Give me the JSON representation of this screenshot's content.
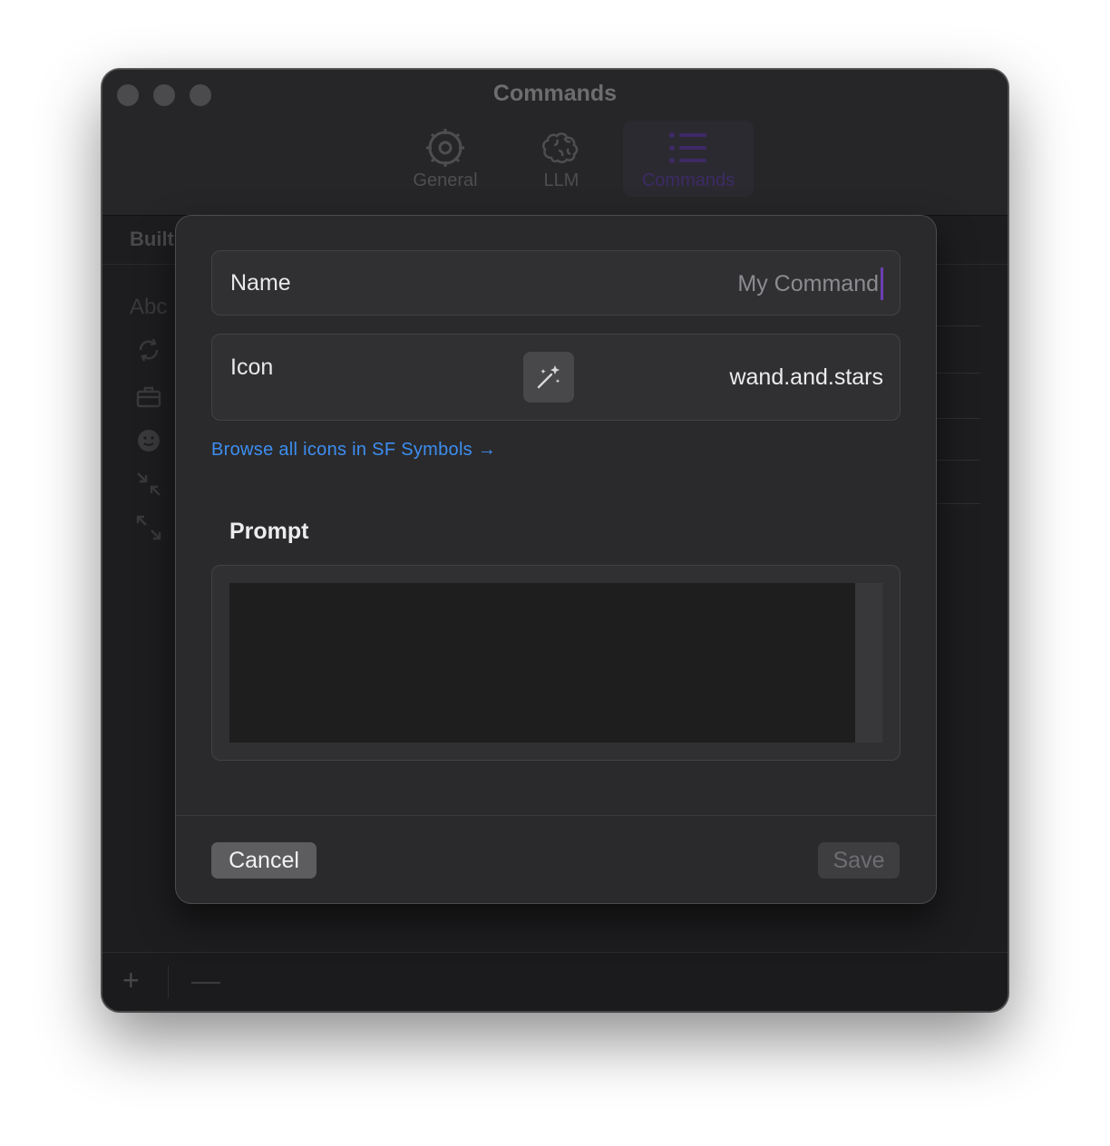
{
  "window": {
    "title": "Commands"
  },
  "tabs": [
    {
      "label": "General",
      "icon": "gear-icon"
    },
    {
      "label": "LLM",
      "icon": "brain-icon"
    },
    {
      "label": "Commands",
      "icon": "list-bullet-icon",
      "active": true
    }
  ],
  "background": {
    "list_header": "Built",
    "first_row_text": "Abc",
    "row_icons": [
      "arrow-rotate-icon",
      "briefcase-icon",
      "smiley-icon",
      "arrows-inward-icon",
      "arrows-outward-icon"
    ],
    "bottom_bar": {
      "add": "+",
      "remove": "—"
    }
  },
  "sheet": {
    "name_label": "Name",
    "name_placeholder": "My Command",
    "name_value": "",
    "icon_label": "Icon",
    "icon_symbol": "wand-and-stars-icon",
    "icon_value": "wand.and.stars",
    "browse_link": "Browse all icons in SF Symbols →",
    "prompt_label": "Prompt",
    "prompt_value": "",
    "cancel_label": "Cancel",
    "save_label": "Save"
  },
  "colors": {
    "link": "#3d8ef0",
    "active_tab_tint": "#3d2a66",
    "cursor": "#6b3fb0"
  }
}
